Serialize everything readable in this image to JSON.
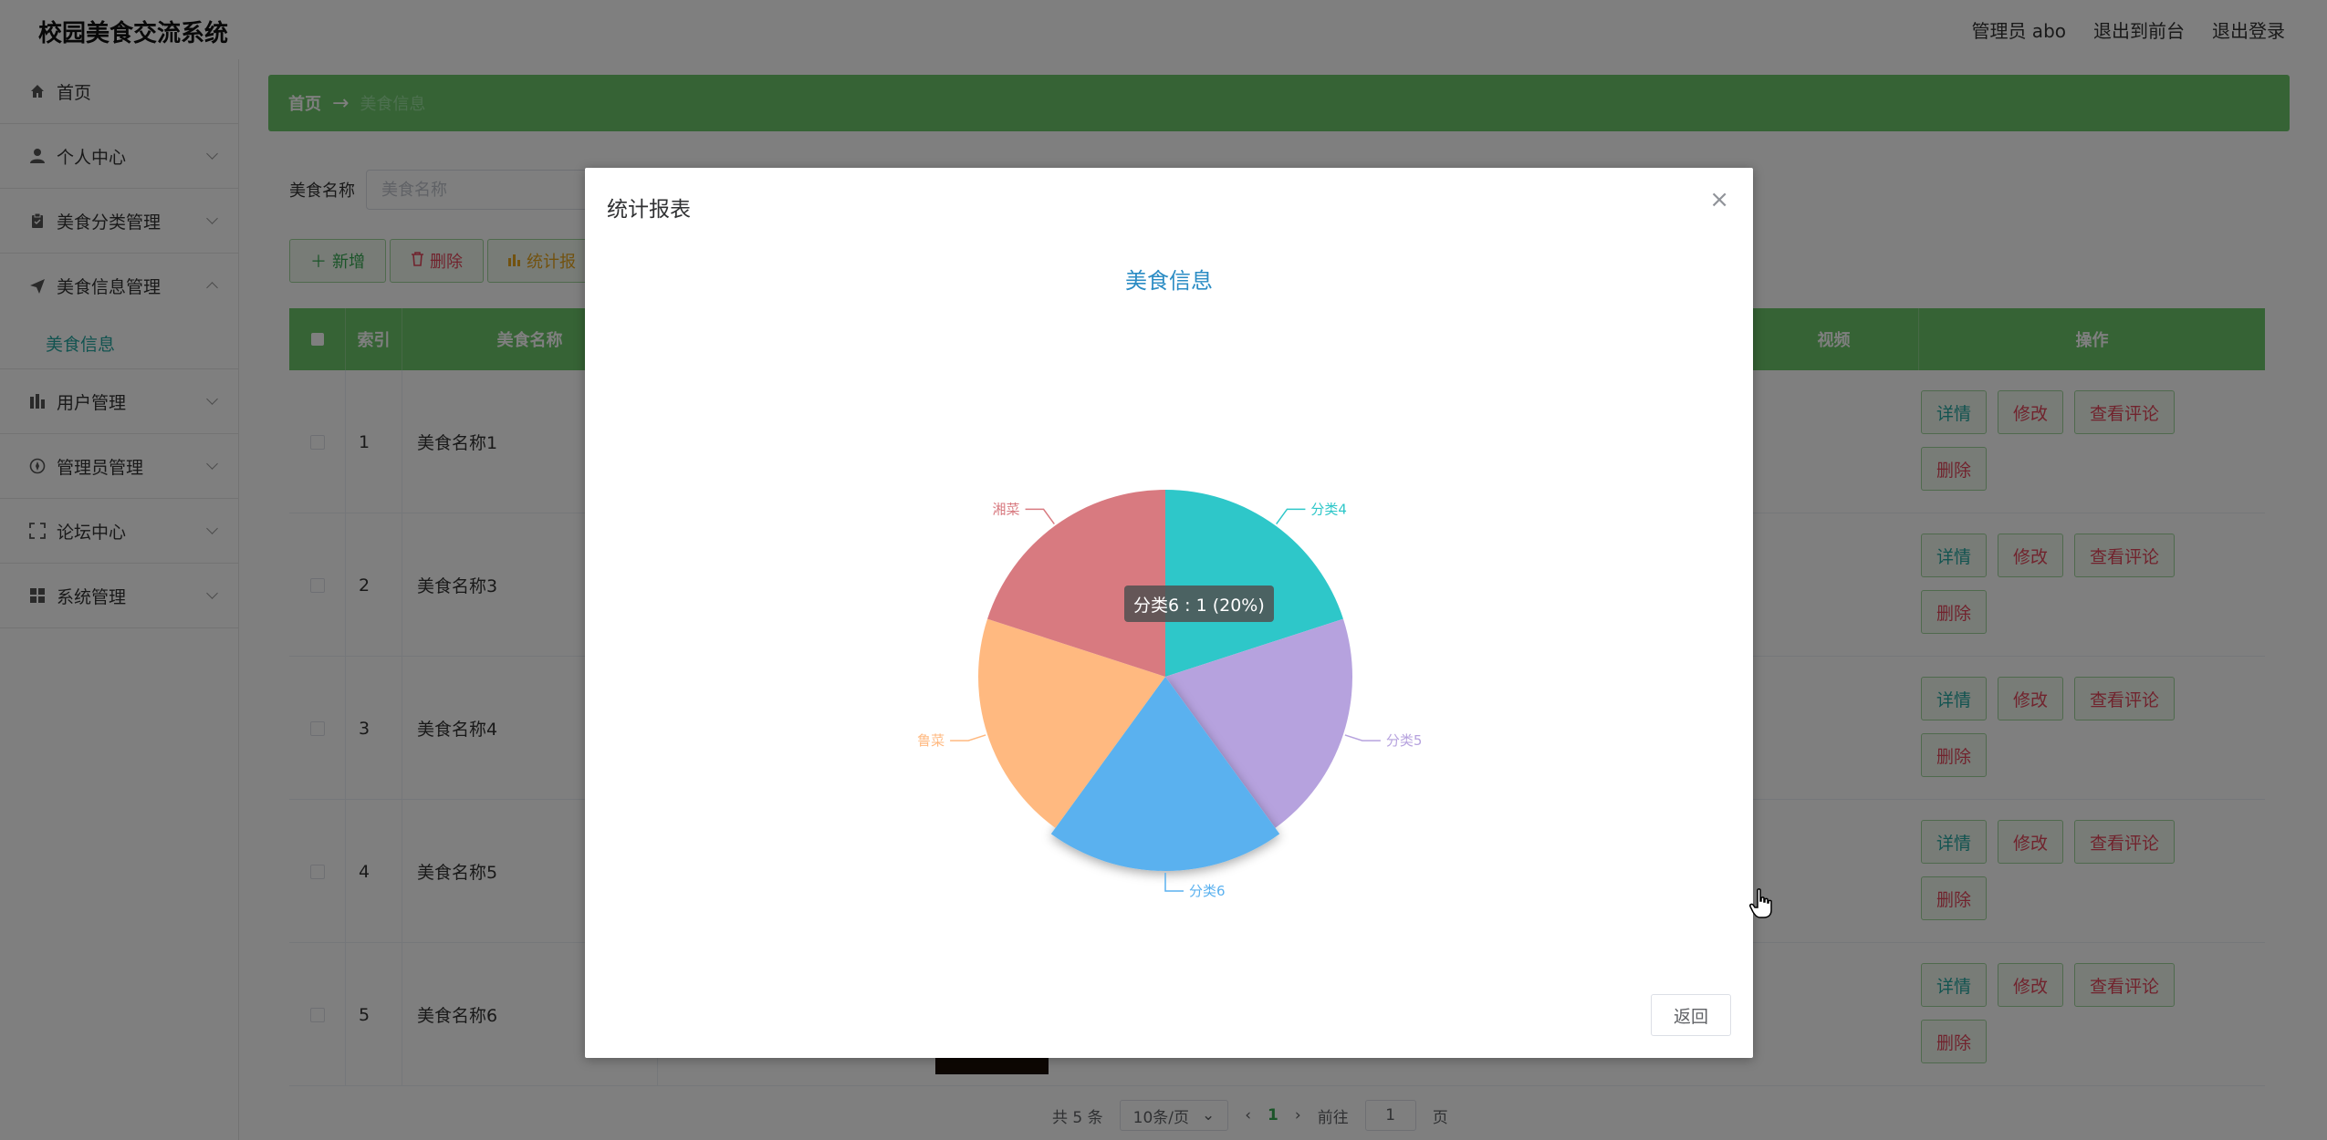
{
  "header": {
    "title": "校园美食交流系统",
    "links": [
      "管理员 abo",
      "退出到前台",
      "退出登录"
    ]
  },
  "sidebar": {
    "items": [
      {
        "label": "首页",
        "icon": "home-icon"
      },
      {
        "label": "个人中心",
        "icon": "user-icon"
      },
      {
        "label": "美食分类管理",
        "icon": "clipboard-icon"
      },
      {
        "label": "美食信息管理",
        "icon": "send-icon"
      },
      {
        "label": "用户管理",
        "icon": "bar-chart-icon"
      },
      {
        "label": "管理员管理",
        "icon": "compass-icon"
      },
      {
        "label": "论坛中心",
        "icon": "fullscreen-icon"
      },
      {
        "label": "系统管理",
        "icon": "grid-icon"
      }
    ],
    "sub_item": "美食信息"
  },
  "breadcrumb": {
    "home": "首页",
    "arrow": "→",
    "current": "美食信息"
  },
  "search": {
    "label": "美食名称",
    "placeholder": "美食名称"
  },
  "buttons": {
    "add": "新增",
    "delete": "删除",
    "stats": "统计报"
  },
  "table": {
    "headers": [
      "索引",
      "美食名称",
      "视频",
      "操作"
    ],
    "rows": [
      {
        "index": "1",
        "name": "美食名称1"
      },
      {
        "index": "2",
        "name": "美食名称3"
      },
      {
        "index": "3",
        "name": "美食名称4"
      },
      {
        "index": "4",
        "name": "美食名称5"
      },
      {
        "index": "5",
        "name": "美食名称6"
      }
    ],
    "actions": {
      "detail": "详情",
      "edit": "修改",
      "review": "查看评论",
      "remove": "删除"
    }
  },
  "pagination": {
    "total": "共 5 条",
    "page_size": "10条/页",
    "current": "1",
    "goto_label": "前往",
    "goto_value": "1",
    "page_suffix": "页"
  },
  "dialog": {
    "title": "统计报表",
    "close": "×",
    "return_label": "返回",
    "tooltip": "分类6 : 1 (20%)"
  },
  "colors": {
    "primary_green": "#6dc76a",
    "teal": "#25a6a0"
  },
  "chart_data": {
    "type": "pie",
    "title": "美食信息",
    "slices": [
      {
        "name": "分类4",
        "value": 1,
        "color": "#2ec7c9"
      },
      {
        "name": "分类5",
        "value": 1,
        "color": "#b6a2de"
      },
      {
        "name": "分类6",
        "value": 1,
        "color": "#5ab1ef"
      },
      {
        "name": "鲁菜",
        "value": 1,
        "color": "#ffb980"
      },
      {
        "name": "湘菜",
        "value": 1,
        "color": "#d87a80"
      }
    ],
    "highlighted": "分类6"
  }
}
